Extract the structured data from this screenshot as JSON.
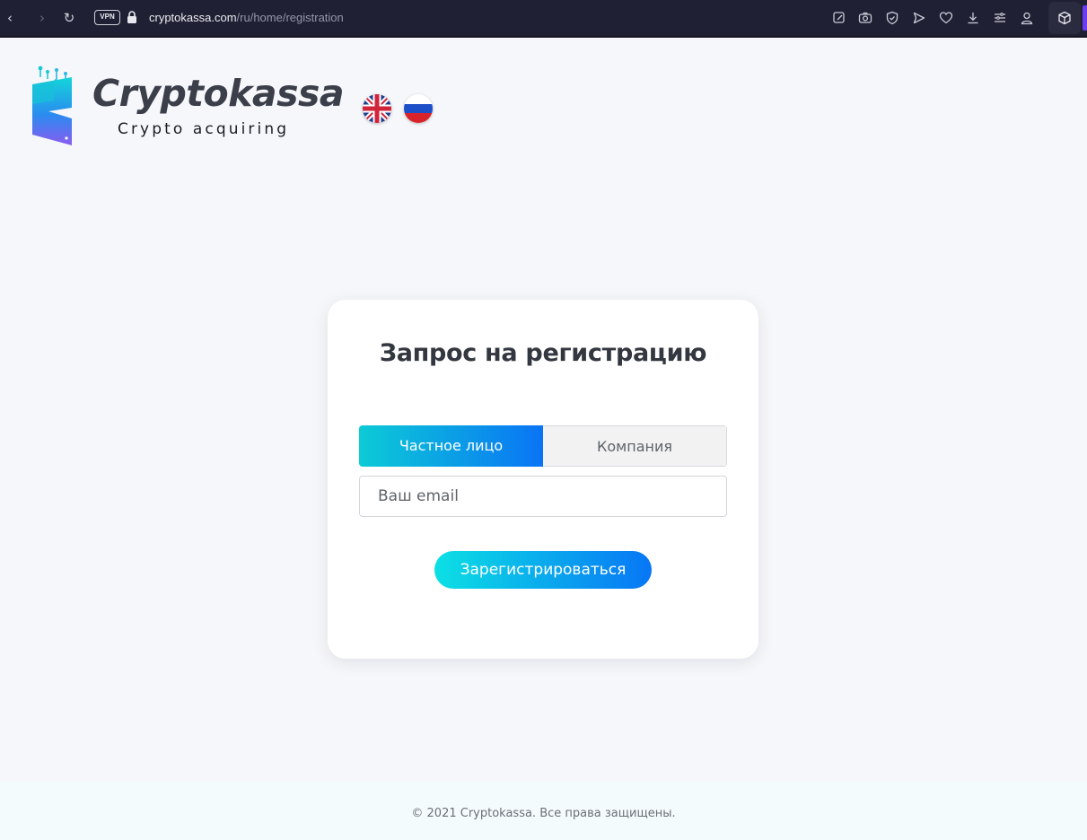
{
  "browser": {
    "url_host": "cryptokassa.com",
    "url_path": "/ru/home/registration",
    "vpn_label": "VPN",
    "icons": [
      "back-icon",
      "forward-icon",
      "reload-icon",
      "lock-icon",
      "edit-icon",
      "camera-icon",
      "shield-icon",
      "send-icon",
      "heart-icon",
      "download-icon",
      "menu-icon",
      "profile-icon",
      "extension-cube-icon"
    ]
  },
  "header": {
    "logo_title": "Cryptokassa",
    "logo_subtitle": "Crypto acquiring",
    "languages": [
      "en-flag-icon",
      "ru-flag-icon"
    ]
  },
  "form": {
    "title": "Запрос на регистрацию",
    "tabs": [
      {
        "label": "Частное лицо",
        "active": true
      },
      {
        "label": "Компания",
        "active": false
      }
    ],
    "email_placeholder": "Ваш email",
    "email_value": "",
    "submit_label": "Зарегистрироваться"
  },
  "footer": {
    "copyright": "© 2021 Cryptokassa. Все права защищены."
  },
  "colors": {
    "accent_start": "#0ccbd6",
    "accent_end": "#0a74f5",
    "page_bg": "#f6f7fa",
    "chrome_bg": "#1f2033"
  }
}
